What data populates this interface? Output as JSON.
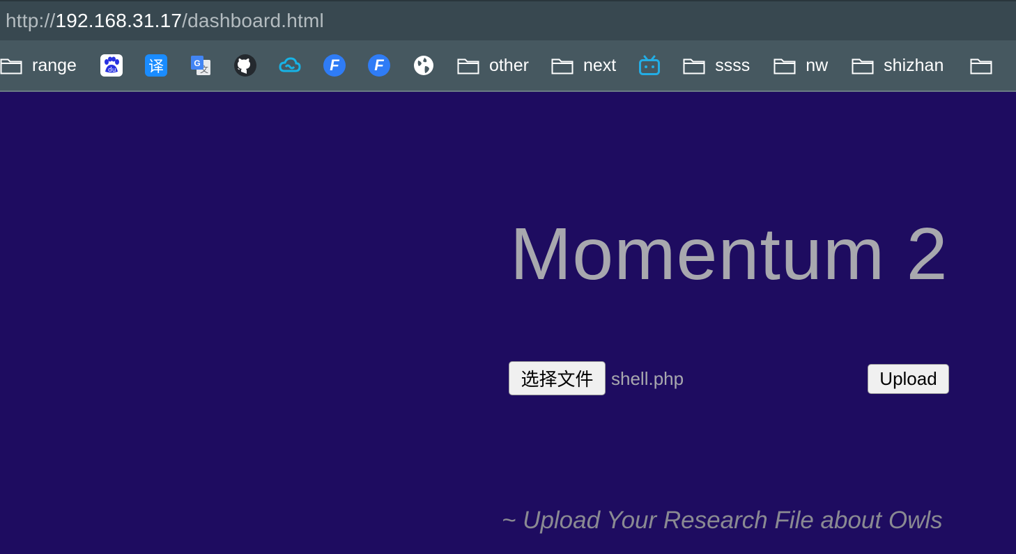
{
  "browser": {
    "url": {
      "scheme": "http://",
      "host": "192.168.31.17",
      "path": "/dashboard.html"
    },
    "bookmarks": [
      {
        "type": "folder",
        "label": "range",
        "icon": "folder-icon"
      },
      {
        "type": "site",
        "label": "",
        "icon": "baidu-icon",
        "glyph": "du",
        "color": "#2932e1"
      },
      {
        "type": "site",
        "label": "",
        "icon": "translate-icon",
        "glyph": "译",
        "color": "#1a8cff"
      },
      {
        "type": "site",
        "label": "",
        "icon": "google-translate-icon",
        "glyph": "G",
        "color": "#4285f4"
      },
      {
        "type": "site",
        "label": "",
        "icon": "github-icon",
        "color": "#24292e"
      },
      {
        "type": "site",
        "label": "",
        "icon": "cloud-icon",
        "color": "#17b3e6"
      },
      {
        "type": "site",
        "label": "",
        "icon": "fofa-icon",
        "glyph": "F",
        "color": "#2f7cf6"
      },
      {
        "type": "site",
        "label": "",
        "icon": "fofa-icon",
        "glyph": "F",
        "color": "#2f7cf6"
      },
      {
        "type": "site",
        "label": "",
        "icon": "globe-icon",
        "color": "#ffffff"
      },
      {
        "type": "folder",
        "label": "other",
        "icon": "folder-icon"
      },
      {
        "type": "folder",
        "label": "next",
        "icon": "folder-icon"
      },
      {
        "type": "site",
        "label": "",
        "icon": "bilibili-icon",
        "color": "#23ade5"
      },
      {
        "type": "folder",
        "label": "ssss",
        "icon": "folder-icon"
      },
      {
        "type": "folder",
        "label": "nw",
        "icon": "folder-icon"
      },
      {
        "type": "folder",
        "label": "shizhan",
        "icon": "folder-icon"
      },
      {
        "type": "folder",
        "label": "",
        "icon": "folder-icon"
      }
    ]
  },
  "page": {
    "title": "Momentum 2",
    "choose_file_label": "选择文件",
    "selected_file": "shell.php",
    "upload_label": "Upload",
    "tagline": "~ Upload Your Research File about Owls"
  },
  "colors": {
    "background": "#1e0c60",
    "title_text": "#a8a8ae",
    "tagline_text": "#8a8a92",
    "urlbar": "#384850",
    "bookmarks_bar": "#465860"
  }
}
